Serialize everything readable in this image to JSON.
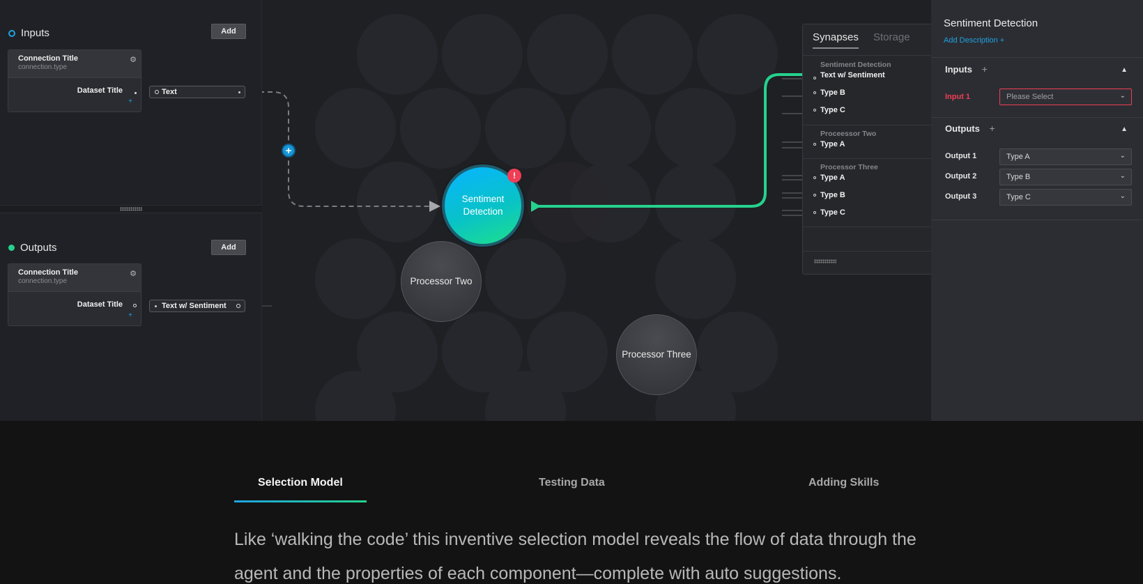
{
  "left_panel": {
    "inputs": {
      "title": "Inputs",
      "add_label": "Add",
      "card": {
        "title": "Connection Title",
        "type": "connection.type",
        "dataset": "Dataset  Title",
        "plus": "+"
      },
      "pill_label": "Text"
    },
    "outputs": {
      "title": "Outputs",
      "add_label": "Add",
      "card": {
        "title": "Connection Title",
        "type": "connection.type",
        "dataset": "Dataset  Title",
        "plus": "+"
      },
      "pill_label": "Text w/ Sentiment"
    }
  },
  "canvas": {
    "active_node": {
      "line1": "Sentiment",
      "line2": "Detection",
      "alert": "!"
    },
    "nodes": [
      "Processor Two",
      "Processor Three"
    ],
    "add_connection": "+"
  },
  "synapses": {
    "tabs": [
      "Synapses",
      "Storage"
    ],
    "groups": [
      {
        "name": "Sentiment Detection",
        "items": [
          "Text w/ Sentiment",
          "Type B",
          "Type C"
        ]
      },
      {
        "name": "Proceessor Two",
        "items": [
          "Type A"
        ]
      },
      {
        "name": "Processor Three",
        "items": [
          "Type A",
          "Type B",
          "Type C"
        ]
      }
    ]
  },
  "properties": {
    "title": "Sentiment Detection",
    "add_description": "Add Description +",
    "inputs_title": "Inputs",
    "outputs_title": "Outputs",
    "plus": "+",
    "inputs": [
      {
        "label": "Input 1",
        "value": "Please Select"
      }
    ],
    "outputs": [
      {
        "label": "Output 1",
        "value": "Type A"
      },
      {
        "label": "Output 2",
        "value": "Type B"
      },
      {
        "label": "Output 3",
        "value": "Type C"
      }
    ]
  },
  "bottom": {
    "tabs": [
      "Selection Model",
      "Testing Data",
      "Adding Skills"
    ],
    "description": "Like ‘walking the code’ this inventive selection model reveals the flow of data through the agent and the properties of each component—complete with auto suggestions."
  },
  "colors": {
    "accent_blue": "#1ea3e0",
    "accent_green": "#25d28d",
    "alert_red": "#ef3e55",
    "background": "#1f2024"
  },
  "icons": [
    "gear-icon",
    "chevron-down-icon",
    "chevron-up-icon",
    "plus-icon",
    "alert-icon",
    "grip-icon"
  ]
}
